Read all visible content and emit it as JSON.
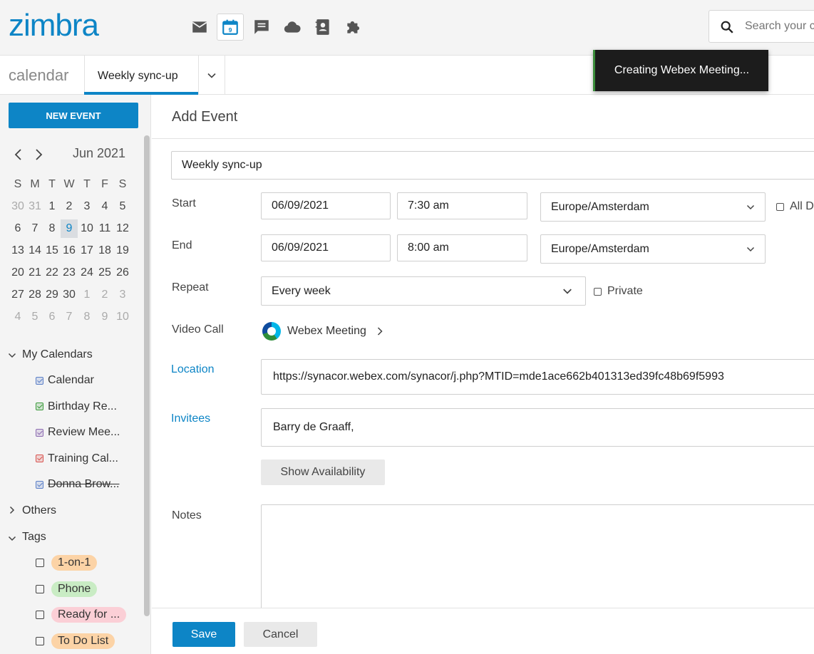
{
  "header": {
    "logo_text": "zimbra",
    "search_placeholder": "Search your ca",
    "apps": [
      {
        "icon": "mail-icon",
        "active": false
      },
      {
        "icon": "calendar-icon",
        "active": true,
        "badge": "9"
      },
      {
        "icon": "chat-icon",
        "active": false
      },
      {
        "icon": "cloud-icon",
        "active": false
      },
      {
        "icon": "contacts-icon",
        "active": false
      },
      {
        "icon": "puzzle-icon",
        "active": false
      }
    ]
  },
  "subbar": {
    "app_name": "calendar",
    "tab_label": "Weekly sync-up"
  },
  "toast": {
    "message": "Creating Webex Meeting..."
  },
  "sidebar": {
    "new_event_label": "NEW EVENT",
    "mini_calendar": {
      "month_label": "Jun 2021",
      "weekday_headers": [
        "S",
        "M",
        "T",
        "W",
        "T",
        "F",
        "S"
      ],
      "weeks": [
        [
          "30",
          "31",
          "1",
          "2",
          "3",
          "4",
          "5"
        ],
        [
          "6",
          "7",
          "8",
          "9",
          "10",
          "11",
          "12"
        ],
        [
          "13",
          "14",
          "15",
          "16",
          "17",
          "18",
          "19"
        ],
        [
          "20",
          "21",
          "22",
          "23",
          "24",
          "25",
          "26"
        ],
        [
          "27",
          "28",
          "29",
          "30",
          "1",
          "2",
          "3"
        ],
        [
          "4",
          "5",
          "6",
          "7",
          "8",
          "9",
          "10"
        ]
      ],
      "selected_day": "9"
    },
    "my_calendars_label": "My Calendars",
    "calendars": [
      {
        "label": "Calendar",
        "color": "#5b7fc7",
        "checked": true
      },
      {
        "label": "Birthday Re...",
        "color": "#3a9a3a",
        "checked": true
      },
      {
        "label": "Review Mee...",
        "color": "#8c6bb1",
        "checked": true
      },
      {
        "label": "Training Cal...",
        "color": "#d9534f",
        "checked": true
      },
      {
        "label": "Donna Brow...",
        "color": "#5b7fc7",
        "checked": true,
        "strikethrough": true
      }
    ],
    "others_label": "Others",
    "tags_label": "Tags",
    "tags": [
      {
        "label": "1-on-1",
        "color": "#fcd3a6"
      },
      {
        "label": "Phone",
        "color": "#c9ecc4"
      },
      {
        "label": "Ready for ...",
        "color": "#fbcfd6"
      },
      {
        "label": "To Do List",
        "color": "#fcd3a6"
      }
    ]
  },
  "form": {
    "heading": "Add Event",
    "title_value": "Weekly sync-up",
    "start_label": "Start",
    "start_date": "06/09/2021",
    "start_time": "7:30 am",
    "start_timezone": "Europe/Amsterdam",
    "all_day_label": "All D",
    "end_label": "End",
    "end_date": "06/09/2021",
    "end_time": "8:00 am",
    "end_timezone": "Europe/Amsterdam",
    "repeat_label": "Repeat",
    "repeat_value": "Every week",
    "private_label": "Private",
    "video_call_label": "Video Call",
    "video_call_value": "Webex Meeting",
    "location_label": "Location",
    "location_value": "https://synacor.webex.com/synacor/j.php?MTID=mde1ace662b401313ed39fc48b69f5993",
    "invitees_label": "Invitees",
    "invitees_value": "Barry de Graaff,",
    "show_availability_label": "Show Availability",
    "notes_label": "Notes",
    "save_label": "Save",
    "cancel_label": "Cancel"
  },
  "colors": {
    "accent": "#0d85c6",
    "toast_bg": "#1c1c1c"
  }
}
